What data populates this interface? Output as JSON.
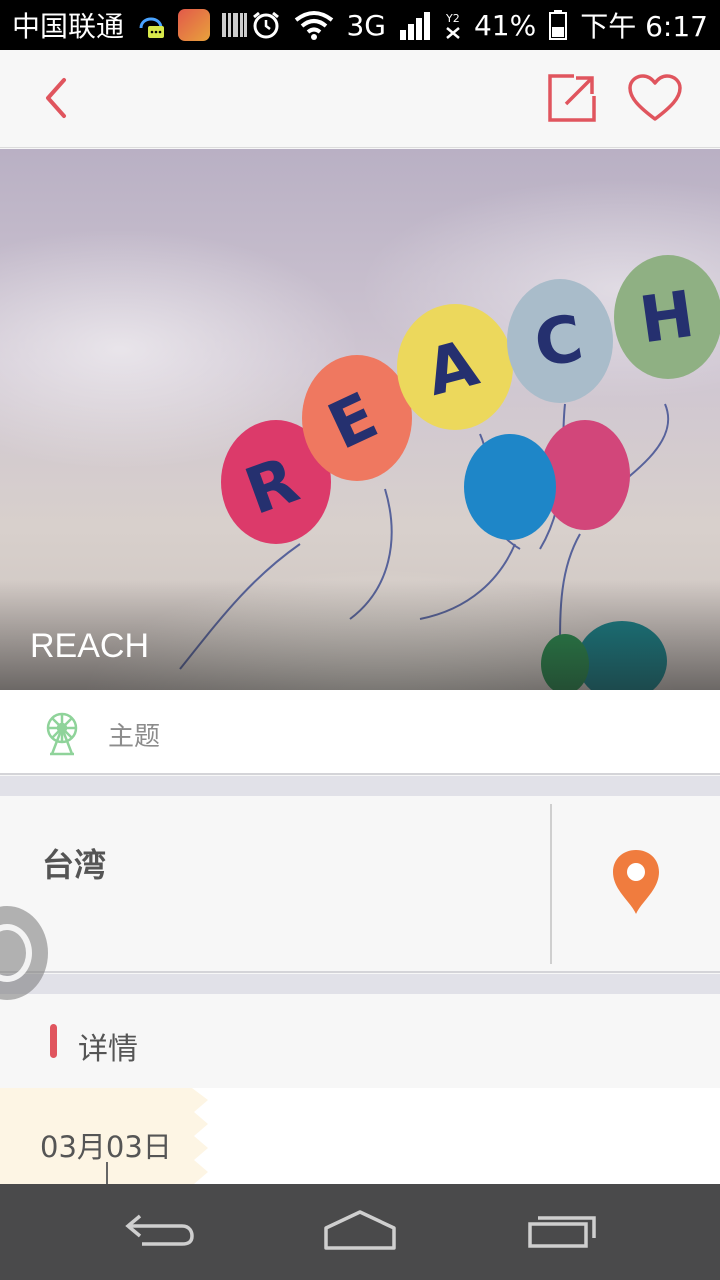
{
  "status_bar": {
    "carrier": "中国联通",
    "network": "3G",
    "battery": "41%",
    "time": "下午 6:17"
  },
  "app_bar": {
    "back_icon": "chevron-left-icon",
    "share_icon": "external-link-icon",
    "favorite_icon": "heart-icon",
    "accent_color": "#e0555e"
  },
  "hero": {
    "title": "REACH",
    "balloon_letters": [
      "R",
      "E",
      "A",
      "C",
      "H"
    ]
  },
  "theme": {
    "icon": "ferris-wheel-icon",
    "label": "主题"
  },
  "location": {
    "name": "台湾",
    "icon": "map-pin-icon",
    "pin_color": "#f07c3e"
  },
  "details": {
    "label": "详情"
  },
  "timeline": {
    "date": "03月03日"
  },
  "nav_bar": {
    "back_icon": "nav-back-icon",
    "home_icon": "nav-home-icon",
    "recents_icon": "nav-recents-icon"
  }
}
